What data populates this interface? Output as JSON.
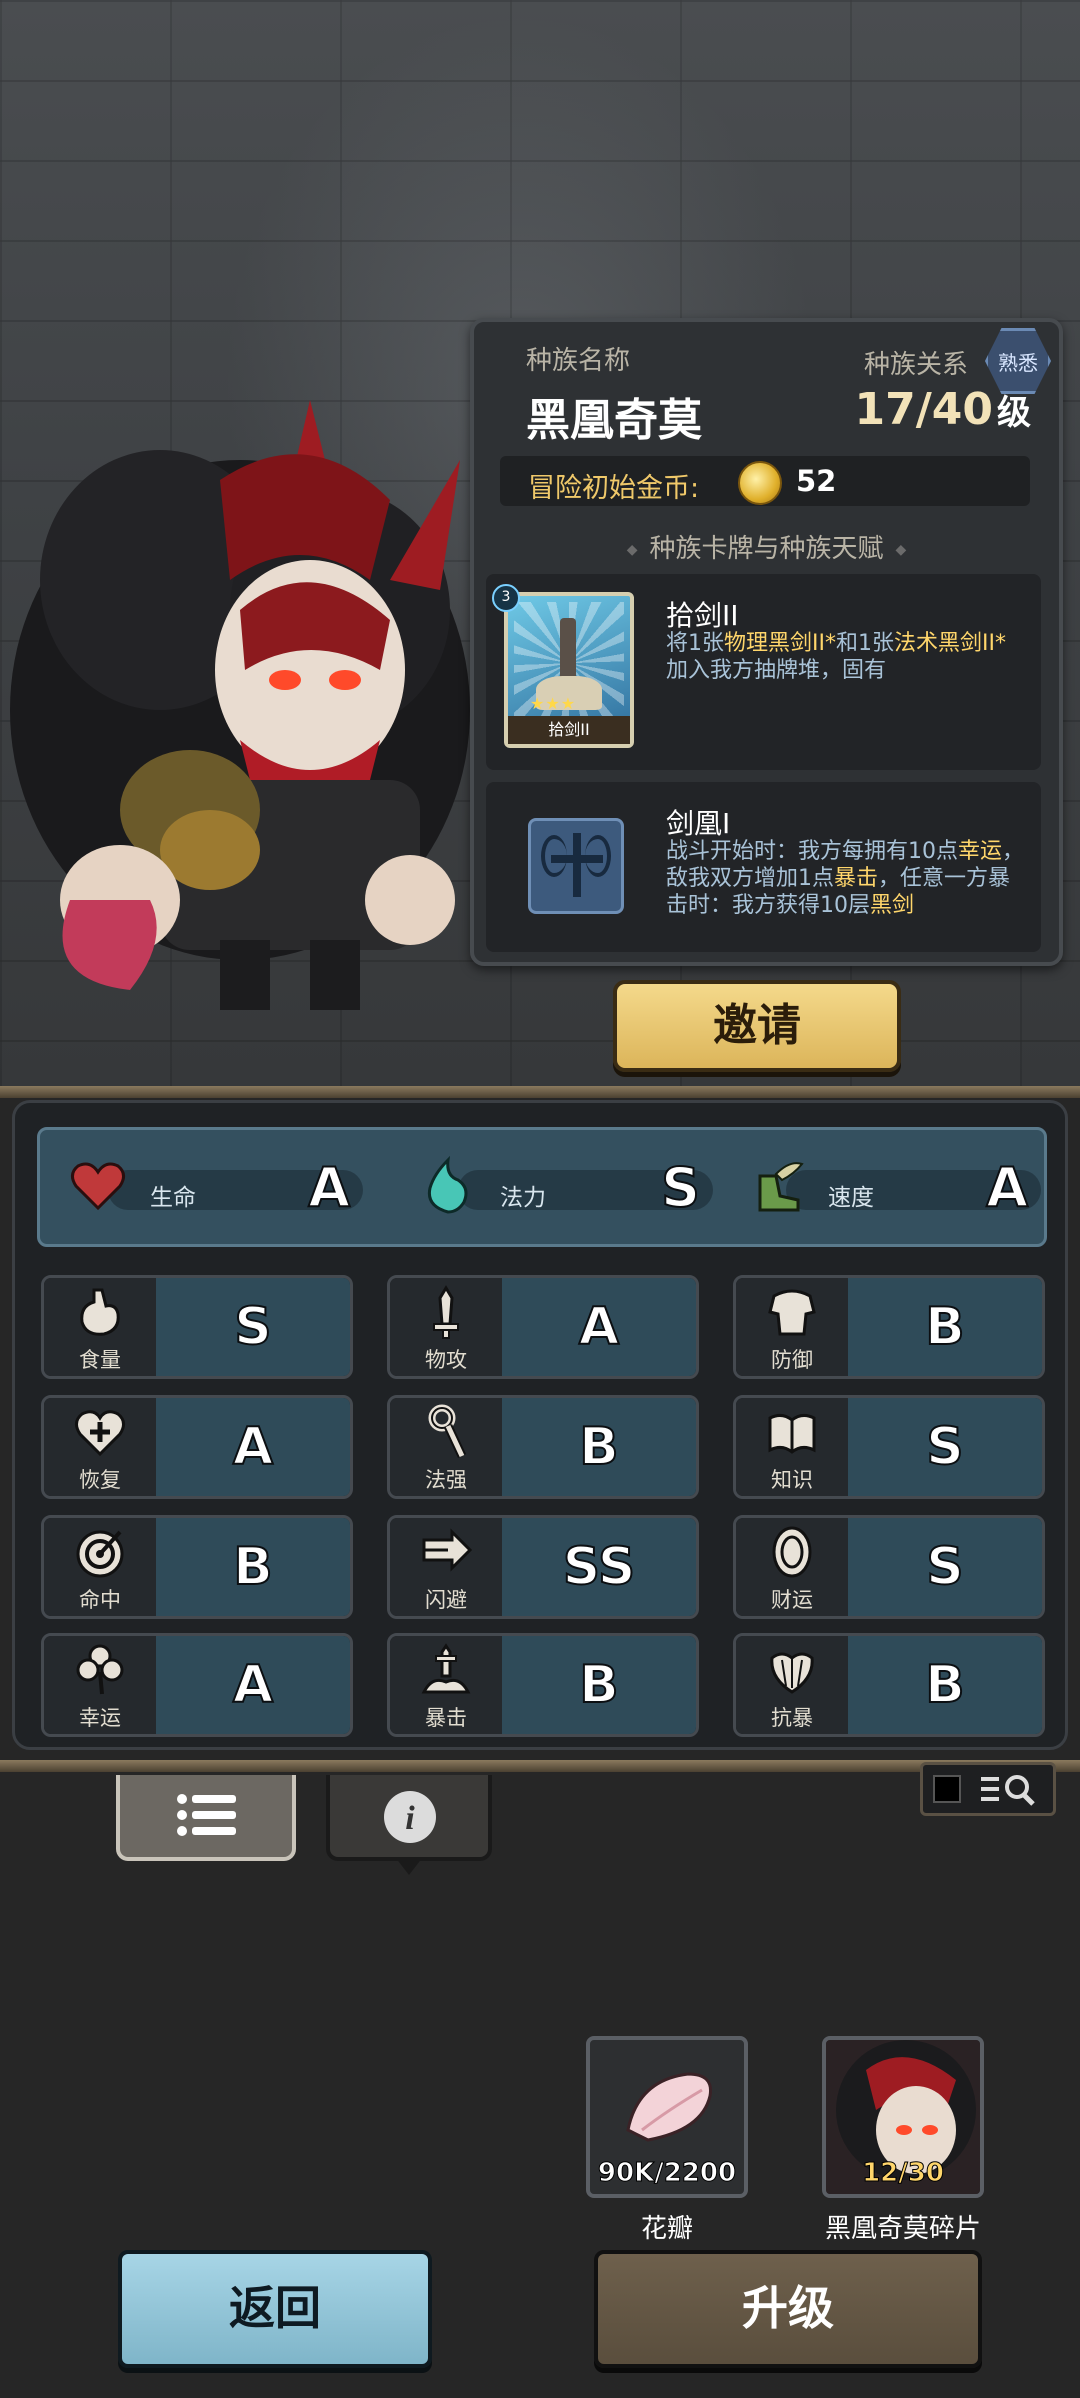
{
  "race": {
    "name_label": "种族名称",
    "name": "黑凰奇莫",
    "relation_label": "种族关系",
    "relation_badge": "熟悉",
    "level": "17/40",
    "level_unit": "级",
    "coin_label": "冒险初始金币:",
    "coin_value": "52",
    "section_title": "种族卡牌与种族天赋"
  },
  "card": {
    "cost": "3",
    "thumb_caption": "拾剑II",
    "title": "拾剑II",
    "desc_1": "将1张",
    "desc_hl_1": "物理黑剑II*",
    "desc_2": "和1张",
    "desc_hl_2": "法术黑剑II*",
    "desc_3": "加入我方抽牌堆，固有"
  },
  "talent": {
    "title": "剑凰I",
    "desc_1": "战斗开始时：我方每拥有10点",
    "desc_hl_1": "幸运",
    "desc_2": "，敌我双方增加1点",
    "desc_hl_2": "暴击",
    "desc_3": "，任意一方暴击时：我方获得10层",
    "desc_hl_3": "黑剑"
  },
  "invite_label": "邀请",
  "top_stats": [
    {
      "name": "生命",
      "grade": "A",
      "icon": "heart-icon",
      "color": "#c0393a"
    },
    {
      "name": "法力",
      "grade": "S",
      "icon": "mana-flame-icon",
      "color": "#48c6b6"
    },
    {
      "name": "速度",
      "grade": "A",
      "icon": "winged-boot-icon",
      "color": "#6a9a4a"
    }
  ],
  "attributes": [
    {
      "name": "食量",
      "grade": "S",
      "icon": "stomach-icon"
    },
    {
      "name": "物攻",
      "grade": "A",
      "icon": "sword-icon"
    },
    {
      "name": "防御",
      "grade": "B",
      "icon": "armor-icon"
    },
    {
      "name": "恢复",
      "grade": "A",
      "icon": "heart-plus-icon"
    },
    {
      "name": "法强",
      "grade": "B",
      "icon": "staff-icon"
    },
    {
      "name": "知识",
      "grade": "S",
      "icon": "book-icon"
    },
    {
      "name": "命中",
      "grade": "B",
      "icon": "target-icon"
    },
    {
      "name": "闪避",
      "grade": "SS",
      "icon": "dodge-arrow-icon"
    },
    {
      "name": "财运",
      "grade": "S",
      "icon": "coin-icon"
    },
    {
      "name": "幸运",
      "grade": "A",
      "icon": "clover-icon"
    },
    {
      "name": "暴击",
      "grade": "B",
      "icon": "crit-sword-icon"
    },
    {
      "name": "抗暴",
      "grade": "B",
      "icon": "shell-icon"
    }
  ],
  "materials": [
    {
      "name": "花瓣",
      "count": "90K/2200",
      "icon": "petal-icon"
    },
    {
      "name": "黑凰奇莫碎片",
      "count": "12/30",
      "icon": "hero-shard-icon"
    }
  ],
  "buttons": {
    "back": "返回",
    "upgrade": "升级"
  }
}
